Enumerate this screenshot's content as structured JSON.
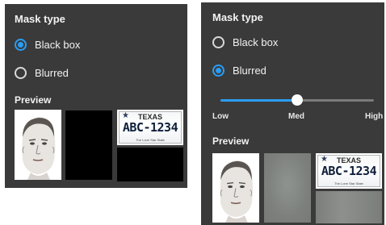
{
  "left_panel": {
    "title": "Mask type",
    "options": [
      {
        "label": "Black box",
        "selected": true
      },
      {
        "label": "Blurred",
        "selected": false
      }
    ],
    "preview_label": "Preview",
    "plate": {
      "state": "TEXAS",
      "number": "ABC-1234",
      "slogan": "The Lone Star State"
    }
  },
  "right_panel": {
    "title": "Mask type",
    "options": [
      {
        "label": "Black box",
        "selected": false
      },
      {
        "label": "Blurred",
        "selected": true
      }
    ],
    "blur_slider": {
      "value_fraction": 0.5,
      "labels": [
        "Low",
        "Med",
        "High"
      ]
    },
    "preview_label": "Preview",
    "plate": {
      "state": "TEXAS",
      "number": "ABC-1234",
      "slogan": "The Lone Star State"
    }
  },
  "colors": {
    "panel_bg": "#3a3a3a",
    "accent": "#2a9df4",
    "text": "#f2f2f2"
  }
}
